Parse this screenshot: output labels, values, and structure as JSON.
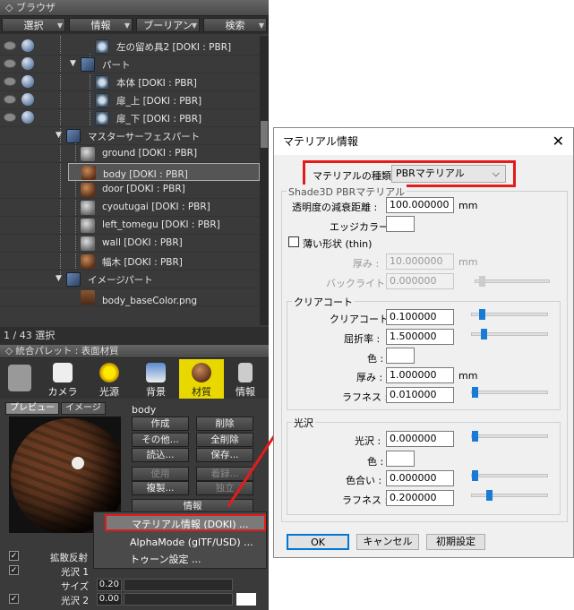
{
  "browser": {
    "title": "ブラウザ",
    "buttons": [
      "選択",
      "情報",
      "ブーリアン",
      "検索"
    ],
    "status": "1 / 43 選択"
  },
  "tree": [
    {
      "label": "左の留め具2 [DOKI : PBR]",
      "icon": "object-icon"
    },
    {
      "label": "パート",
      "icon": "part-icon"
    },
    {
      "label": "本体 [DOKI : PBR]",
      "icon": "object-icon"
    },
    {
      "label": "扉_上 [DOKI : PBR]",
      "icon": "object-icon"
    },
    {
      "label": "扉_下 [DOKI : PBR]",
      "icon": "object-icon"
    },
    {
      "label": "マスターサーフェスパート",
      "icon": "part-icon"
    },
    {
      "label": "ground [DOKI : PBR]",
      "icon": "material-icon"
    },
    {
      "label": "body [DOKI : PBR]",
      "icon": "material-icon"
    },
    {
      "label": "door [DOKI : PBR]",
      "icon": "material-icon"
    },
    {
      "label": "cyoutugai [DOKI : PBR]",
      "icon": "material-icon"
    },
    {
      "label": "left_tomegu [DOKI : PBR]",
      "icon": "material-icon"
    },
    {
      "label": "wall [DOKI : PBR]",
      "icon": "material-icon"
    },
    {
      "label": "幅木 [DOKI : PBR]",
      "icon": "material-icon"
    },
    {
      "label": "イメージパート",
      "icon": "part-icon"
    },
    {
      "label": "body_baseColor.png",
      "icon": "image-icon"
    }
  ],
  "palette": {
    "title": "統合パレット : 表面材質",
    "tabs": [
      "カメラ",
      "光源",
      "背景",
      "材質",
      "情報"
    ],
    "preview_tabs": [
      "プレビュー",
      "イメージ"
    ],
    "material_name": "body",
    "buttons": [
      "作成",
      "削除",
      "その他...",
      "全削除",
      "読込...",
      "保存...",
      "使用",
      "着録...",
      "複製...",
      "独立"
    ],
    "info_button": "情報",
    "props": [
      {
        "label": "拡散反射",
        "value": ""
      },
      {
        "label": "光沢 1",
        "value": ""
      },
      {
        "label": "サイズ",
        "value": "0.20"
      },
      {
        "label": "光沢 2",
        "value": "0.00"
      }
    ]
  },
  "context_menu": [
    "マテリアル情報 (DOKI) ...",
    "AlphaMode (glTF/USD) ...",
    "トゥーン設定 ..."
  ],
  "dialog": {
    "title": "マテリアル情報",
    "close": "✕",
    "type_label": "マテリアルの種類:",
    "type_value": "PBRマテリアル",
    "group1": "Shade3D PBRマテリアル",
    "transmission_label": "透明度の減衰距離 :",
    "transmission_value": "100.000000",
    "unit": "mm",
    "edge_color_label": "エッジカラー :",
    "thin_label": "薄い形状 (thin)",
    "thickness_label": "厚み :",
    "thickness_value": "10.000000",
    "backlight_label": "バックライト :",
    "backlight_value": "0.000000",
    "clearcoat_group": "クリアコート",
    "clearcoat": [
      {
        "label": "クリアコート :",
        "value": "0.100000"
      },
      {
        "label": "屈折率 :",
        "value": "1.500000"
      },
      {
        "label": "色 :",
        "value": ""
      },
      {
        "label": "厚み :",
        "value": "1.000000"
      },
      {
        "label": "ラフネス :",
        "value": "0.010000"
      }
    ],
    "sheen_group": "光沢",
    "sheen": [
      {
        "label": "光沢 :",
        "value": "0.000000"
      },
      {
        "label": "色 :",
        "value": ""
      },
      {
        "label": "色合い :",
        "value": "0.000000"
      },
      {
        "label": "ラフネス :",
        "value": "0.200000"
      }
    ],
    "ok": "OK",
    "cancel": "キャンセル",
    "reset": "初期設定"
  }
}
